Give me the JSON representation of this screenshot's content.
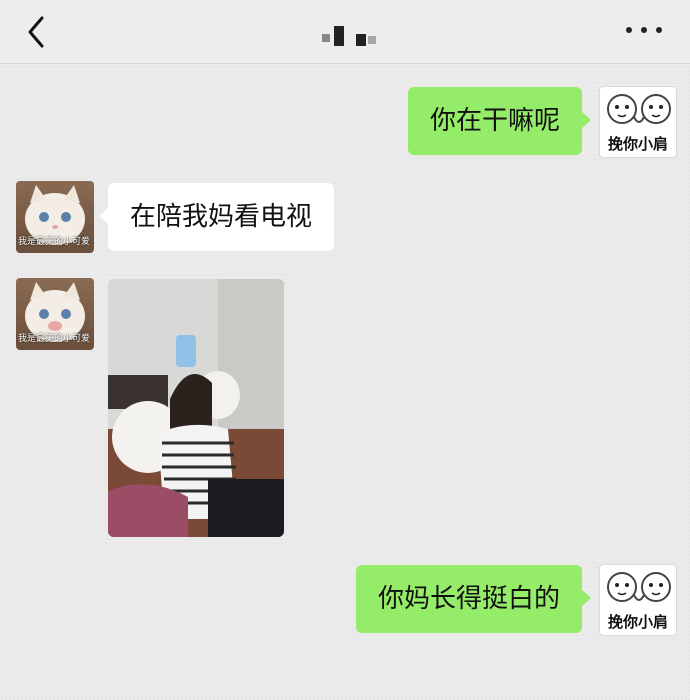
{
  "header": {
    "title_icon": "redacted-name-blocks",
    "back_icon": "chevron-left-icon",
    "more_icon": "more-dots-icon"
  },
  "messages": [
    {
      "side": "right",
      "type": "text",
      "text": "你在干嘛呢",
      "avatar_caption": "挽你小肩"
    },
    {
      "side": "left",
      "type": "text",
      "text": "在陪我妈看电视",
      "avatar_caption": "我是最美的小可爱"
    },
    {
      "side": "left",
      "type": "image",
      "image_desc": "photo",
      "avatar_caption": "我是最美的小可爱"
    },
    {
      "side": "right",
      "type": "text",
      "text": "你妈长得挺白的",
      "avatar_caption": "挽你小肩"
    }
  ],
  "colors": {
    "outgoing_bubble": "#95ec69",
    "incoming_bubble": "#ffffff",
    "chat_background": "#ebebeb"
  }
}
